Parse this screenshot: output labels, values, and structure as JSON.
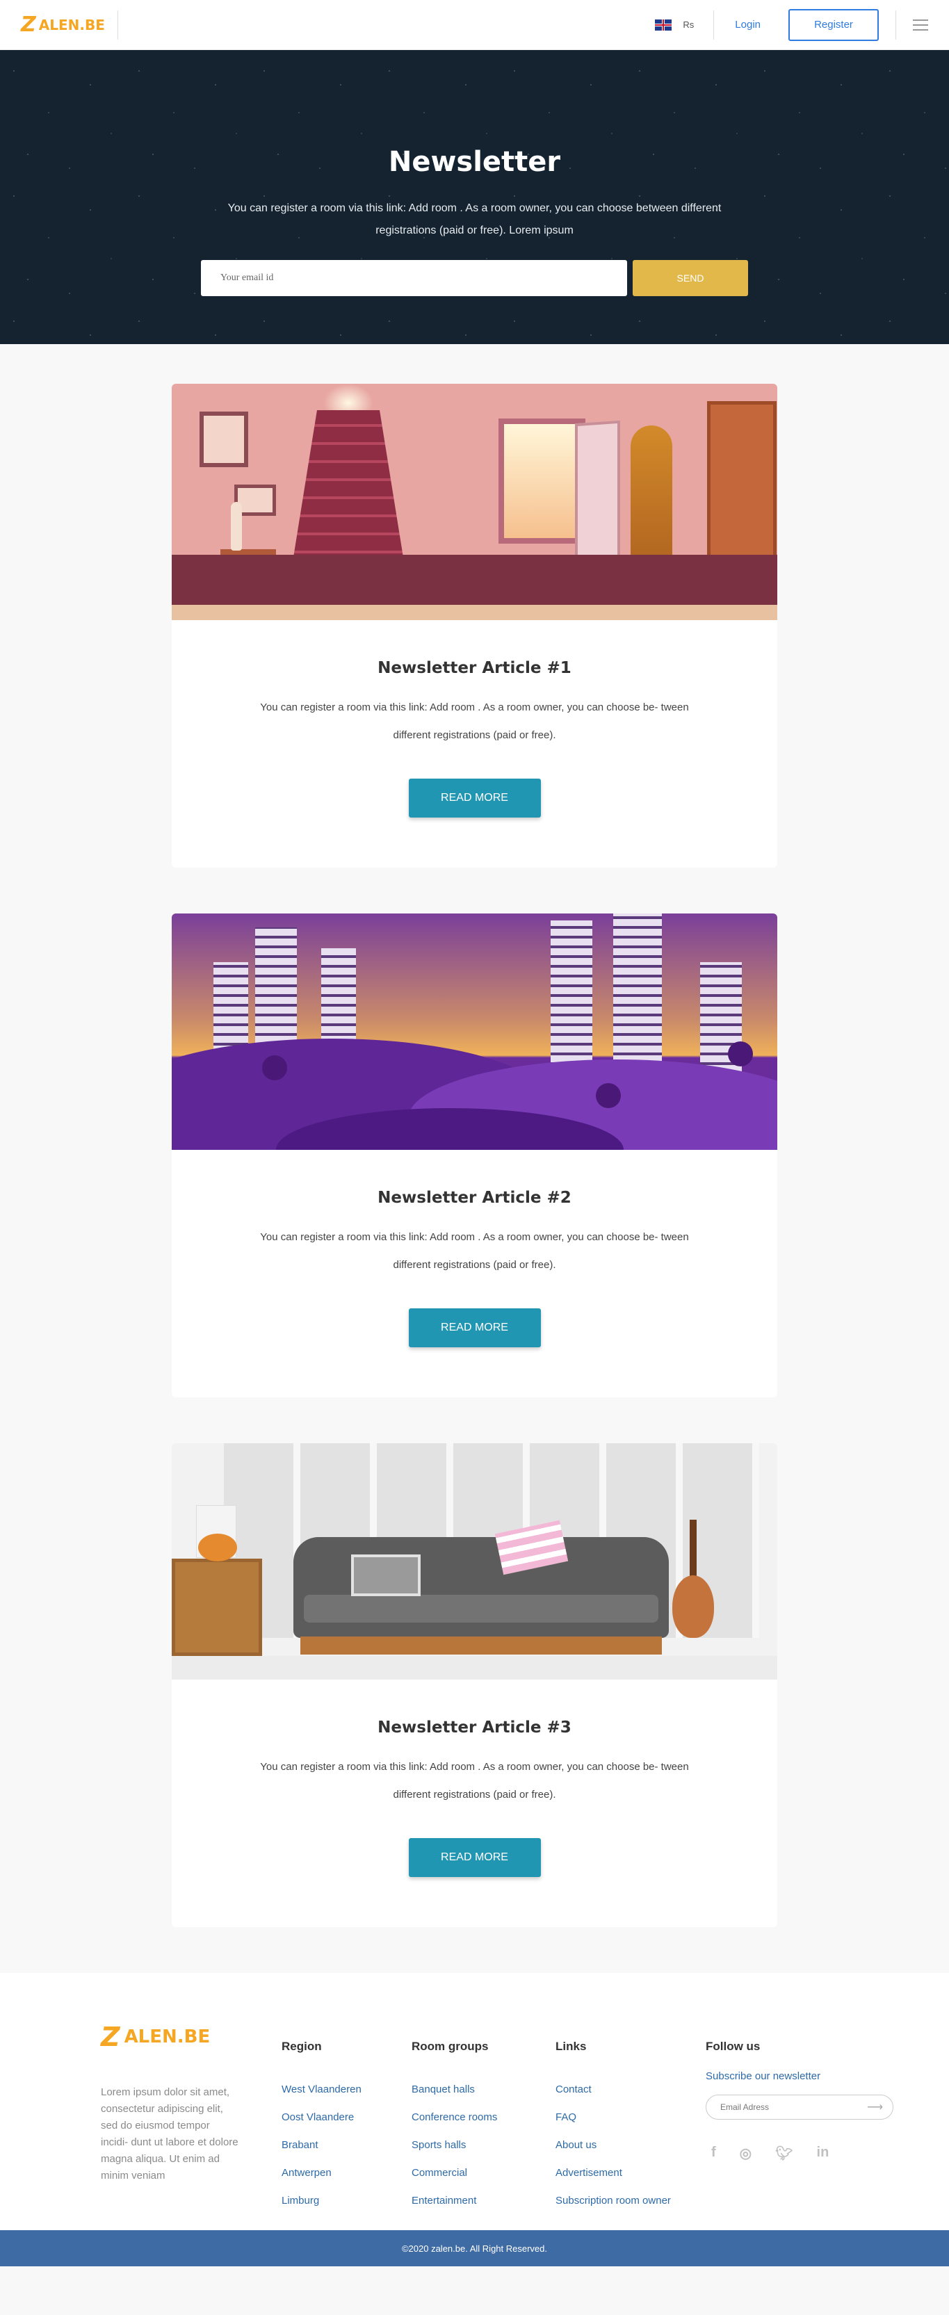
{
  "header": {
    "logo_text": "ALEN.BE",
    "logo_mark": "Z",
    "language": "Rs",
    "login_label": "Login",
    "register_label": "Register"
  },
  "hero": {
    "title": "Newsletter",
    "description": "You can register a room via this link: Add room . As a room owner, you can choose between different registrations (paid or free). Lorem ipsum",
    "email_placeholder": "Your email id",
    "send_label": "SEND"
  },
  "articles": [
    {
      "title": "Newsletter Article #1",
      "text": "You can register a room via this link: Add room . As a room owner, you can choose be- tween different registrations (paid or free).",
      "button": "READ MORE",
      "illustration": "hallway-stairs"
    },
    {
      "title": "Newsletter Article #2",
      "text": "You can register a room via this link: Add room . As a room owner, you can choose be- tween different registrations (paid or free).",
      "button": "READ MORE",
      "illustration": "night-city"
    },
    {
      "title": "Newsletter Article #3",
      "text": "You can register a room via this link: Add room . As a room owner, you can choose be- tween different registrations (paid or free).",
      "button": "READ MORE",
      "illustration": "living-room-sofa"
    }
  ],
  "footer": {
    "logo_text": "ALEN.BE",
    "logo_mark": "Z",
    "description": "Lorem ipsum dolor sit amet, consectetur adipiscing elit, sed do eiusmod tempor incidi- dunt ut labore et dolore magna aliqua. Ut enim ad minim veniam",
    "region": {
      "title": "Region",
      "items": [
        "West Vlaanderen",
        "Oost Vlaandere",
        "Brabant",
        "Antwerpen",
        "Limburg"
      ]
    },
    "room_groups": {
      "title": "Room groups",
      "items": [
        "Banquet halls",
        "Conference rooms",
        "Sports halls",
        "Commercial",
        "Entertainment"
      ]
    },
    "links": {
      "title": "Links",
      "items": [
        "Contact",
        "FAQ",
        "About us",
        "Advertisement",
        "Subscription room owner"
      ]
    },
    "follow": {
      "title": "Follow us",
      "subscribe_label": "Subscribe our newsletter",
      "email_placeholder": "Email Adress",
      "socials": [
        "facebook-icon",
        "instagram-icon",
        "twitter-icon",
        "linkedin-icon"
      ]
    },
    "copyright": "©2020 zalen.be. All Right Reserved."
  },
  "colors": {
    "accent_orange": "#f5a623",
    "send_button": "#e2b84b",
    "read_more": "#2096b3",
    "link_blue": "#2f7be0",
    "bottom_bar": "#3f6ba5",
    "hero_bg": "#14232f"
  }
}
